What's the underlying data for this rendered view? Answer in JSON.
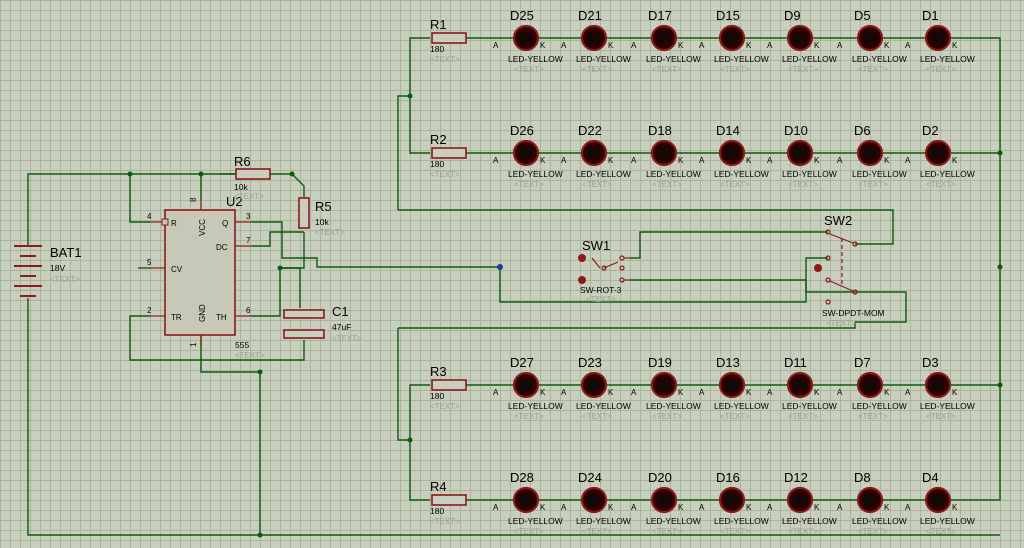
{
  "colors": {
    "wire": "#0d5a10",
    "body": "#8b1a1a",
    "ledfill": "#2a0000",
    "chip": "#c8c8b8",
    "junction": "#0d5a10"
  },
  "placeholder": "<TEXT>",
  "battery": {
    "ref": "BAT1",
    "value": "18V"
  },
  "ic": {
    "ref": "U2",
    "value": "555",
    "pins": {
      "r": "R",
      "vcc": "VCC",
      "q": "Q",
      "dc": "DC",
      "cv": "CV",
      "tr": "TR",
      "gnd": "GND",
      "th": "TH",
      "n4": "4",
      "n8": "8",
      "n3": "3",
      "n7": "7",
      "n5": "5",
      "n2": "2",
      "n1": "1",
      "n6": "6"
    }
  },
  "r6": {
    "ref": "R6",
    "value": "10k"
  },
  "r5": {
    "ref": "R5",
    "value": "10k"
  },
  "c1": {
    "ref": "C1",
    "value": "47uF"
  },
  "sw1": {
    "ref": "SW1",
    "value": "SW-ROT-3"
  },
  "sw2": {
    "ref": "SW2",
    "value": "SW-DPDT-MOM"
  },
  "resistors": [
    {
      "ref": "R1",
      "value": "180"
    },
    {
      "ref": "R2",
      "value": "180"
    },
    {
      "ref": "R3",
      "value": "180"
    },
    {
      "ref": "R4",
      "value": "180"
    }
  ],
  "led_value": "LED-YELLOW",
  "anode": "A",
  "cathode": "K",
  "led_rows": [
    [
      "D25",
      "D21",
      "D17",
      "D15",
      "D9",
      "D5",
      "D1"
    ],
    [
      "D26",
      "D22",
      "D18",
      "D14",
      "D10",
      "D6",
      "D2"
    ],
    [
      "D27",
      "D23",
      "D19",
      "D13",
      "D11",
      "D7",
      "D3"
    ],
    [
      "D28",
      "D24",
      "D20",
      "D16",
      "D12",
      "D8",
      "D4"
    ]
  ]
}
